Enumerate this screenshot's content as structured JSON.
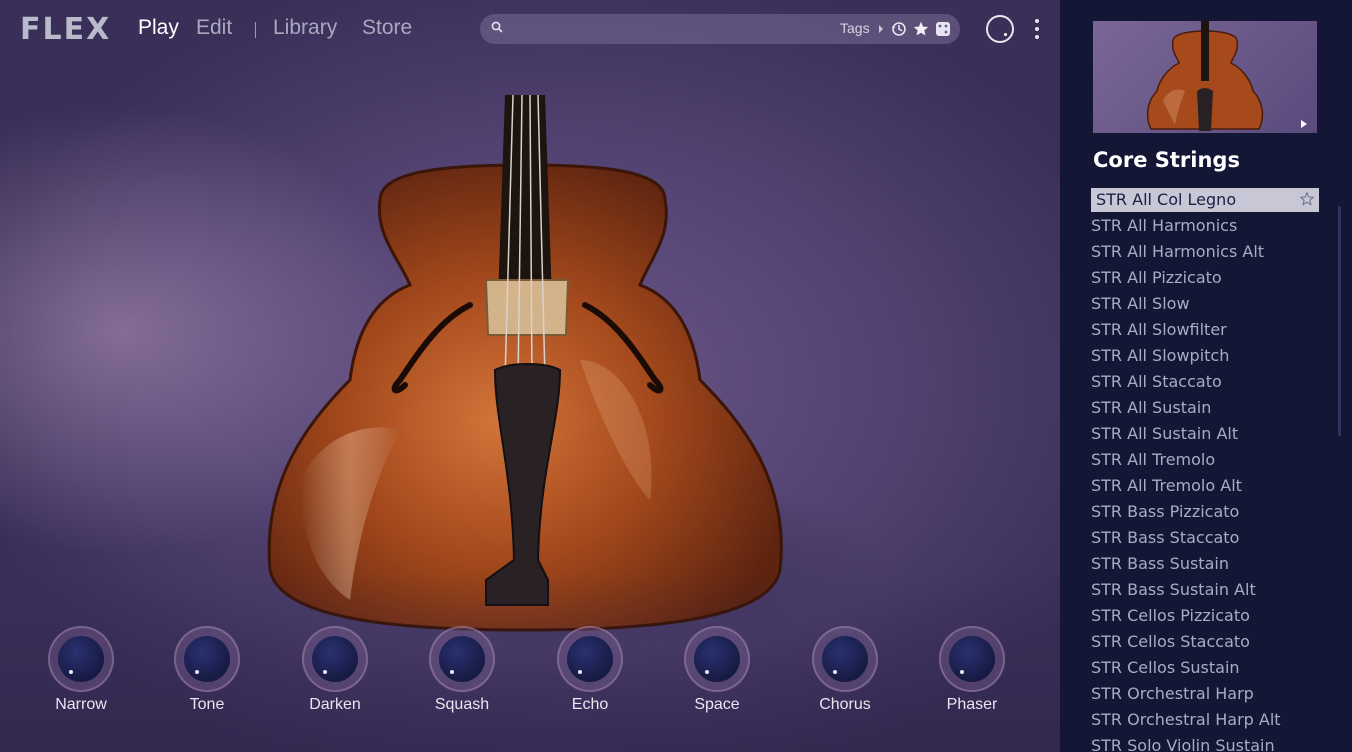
{
  "app": {
    "logo": "FLEX"
  },
  "nav": {
    "tabs": [
      {
        "label": "Play",
        "active": true
      },
      {
        "label": "Edit",
        "active": false
      },
      {
        "label": "Library",
        "active": false
      },
      {
        "label": "Store",
        "active": false
      }
    ]
  },
  "search": {
    "placeholder": "",
    "value": "",
    "tags_label": "Tags",
    "icons": [
      "search-icon",
      "chevron-right-icon",
      "history-icon",
      "star-icon",
      "dice-icon"
    ]
  },
  "macros": [
    {
      "label": "Narrow"
    },
    {
      "label": "Tone"
    },
    {
      "label": "Darken"
    },
    {
      "label": "Squash"
    },
    {
      "label": "Echo"
    },
    {
      "label": "Space"
    },
    {
      "label": "Chorus"
    },
    {
      "label": "Phaser"
    }
  ],
  "library": {
    "title": "Core Strings",
    "presets": [
      "STR All Col Legno",
      "STR All Harmonics",
      "STR All Harmonics Alt",
      "STR All Pizzicato",
      "STR All Slow",
      "STR All Slowfilter",
      "STR All Slowpitch",
      "STR All Staccato",
      "STR All Sustain",
      "STR All Sustain Alt",
      "STR All Tremolo",
      "STR All Tremolo Alt",
      "STR Bass Pizzicato",
      "STR Bass Staccato",
      "STR Bass Sustain",
      "STR Bass Sustain Alt",
      "STR Cellos Pizzicato",
      "STR Cellos Staccato",
      "STR Cellos Sustain",
      "STR Orchestral Harp",
      "STR Orchestral Harp Alt",
      "STR Solo Violin Sustain"
    ],
    "selected_index": 0
  },
  "colors": {
    "accent_selected_bg": "#c7c7d6",
    "panel_bg": "#131735",
    "knob_body": "#161a44"
  }
}
